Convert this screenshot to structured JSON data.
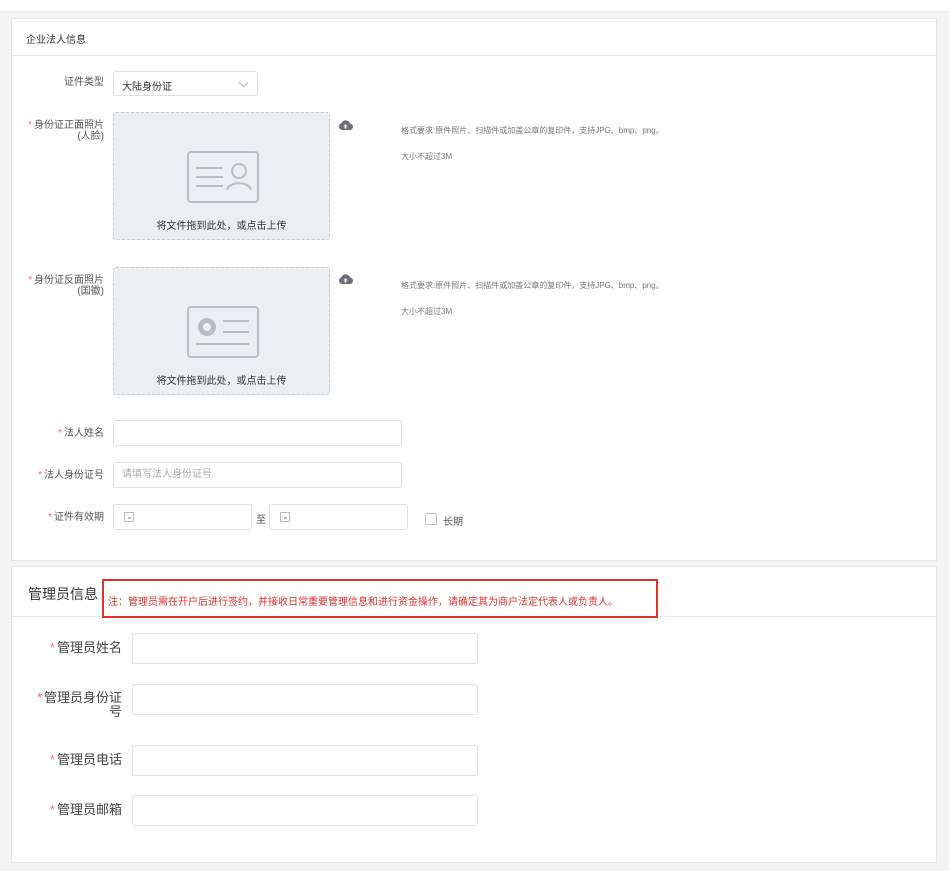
{
  "legal_section": {
    "title": "企业法人信息",
    "cert_type": {
      "label": "证件类型",
      "value": "大陆身份证"
    },
    "id_front": {
      "label_line1": "身份证正面照片",
      "label_line2": "(人脸)",
      "upload_hint": "将文件拖到此处，或点击上传",
      "format_note": "格式要求:原件照片、扫描件或加盖公章的复印件，支持JPG、bmp、png。",
      "size_note": "大小不超过3M"
    },
    "id_back": {
      "label_line1": "身份证反面照片",
      "label_line2": "(国徽)",
      "upload_hint": "将文件拖到此处，或点击上传",
      "format_note": "格式要求:原件照片、扫描件或加盖公章的复印件，支持JPG、bmp、png。",
      "size_note": "大小不超过3M"
    },
    "legal_name": {
      "label": "法人姓名",
      "value": ""
    },
    "legal_id_no": {
      "label": "法人身份证号",
      "placeholder": "请填写法人身份证号"
    },
    "cert_validity": {
      "label": "证件有效期",
      "separator": "至",
      "long_term_label": "长期"
    }
  },
  "admin_section": {
    "title": "管理员信息",
    "notice": "注：管理员需在开户后进行签约，并接收日常重要管理信息和进行资金操作，请确定其为商户法定代表人或负责人。",
    "admin_name": {
      "label": "管理员姓名"
    },
    "admin_id_no": {
      "label_line1": "管理员身份证",
      "label_line2": "号"
    },
    "admin_phone": {
      "label": "管理员电话"
    },
    "admin_email": {
      "label": "管理员邮箱"
    }
  },
  "required_mark": "*",
  "colors": {
    "accent_red": "#e0312c",
    "required": "#f56c6c",
    "upload_bg": "#eceff1"
  },
  "icons": [
    "chevron-down-icon",
    "id-card-front-icon",
    "id-card-back-icon",
    "cloud-upload-icon",
    "calendar-icon"
  ]
}
